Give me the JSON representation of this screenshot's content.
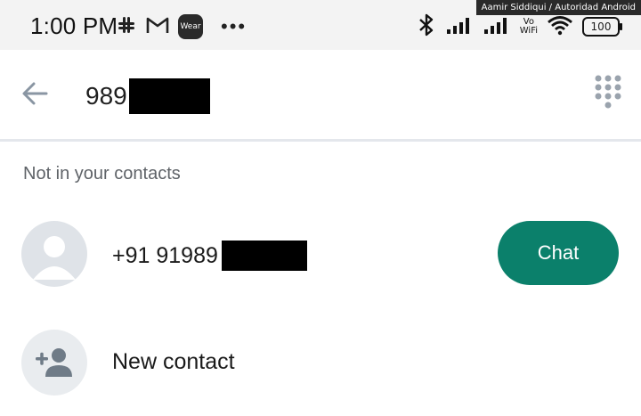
{
  "status_bar": {
    "time": "1:00 PM",
    "watch_badge": "Wear",
    "overflow_dots": "•••",
    "vowifi_top": "Vo",
    "vowifi_bottom": "WiFi",
    "battery": "100",
    "credit": "Aamir Siddiqui / Autoridad Android"
  },
  "search": {
    "query": "989",
    "back_icon": "arrow-left-icon",
    "dialpad_icon": "dialpad-icon"
  },
  "results": {
    "section_label": "Not in your contacts",
    "number_row": {
      "number": "+91 91989",
      "chat_label": "Chat"
    },
    "new_contact_row": {
      "label": "New contact",
      "icon": "add-person-icon"
    }
  },
  "colors": {
    "accent": "#0b806b",
    "status_bar_bg": "#f3f3f3",
    "icon_grey": "#8a96a3",
    "avatar_bg": "#dfe3e8"
  }
}
